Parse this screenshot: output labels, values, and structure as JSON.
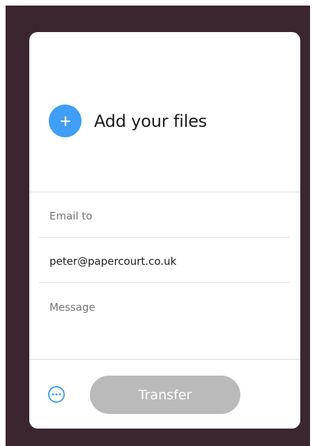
{
  "colors": {
    "backdrop": "#3b2530",
    "card": "#ffffff",
    "accent": "#409ef7",
    "transfer_button_disabled": "#bababa"
  },
  "add_files": {
    "label": "Add your files",
    "icon": "plus-icon"
  },
  "form": {
    "email_to": {
      "placeholder": "Email to",
      "value": ""
    },
    "recipient": {
      "value": "peter@papercourt.co.uk"
    },
    "message": {
      "placeholder": "Message",
      "value": ""
    }
  },
  "footer": {
    "more_icon": "more-options-icon",
    "transfer_label": "Transfer"
  }
}
